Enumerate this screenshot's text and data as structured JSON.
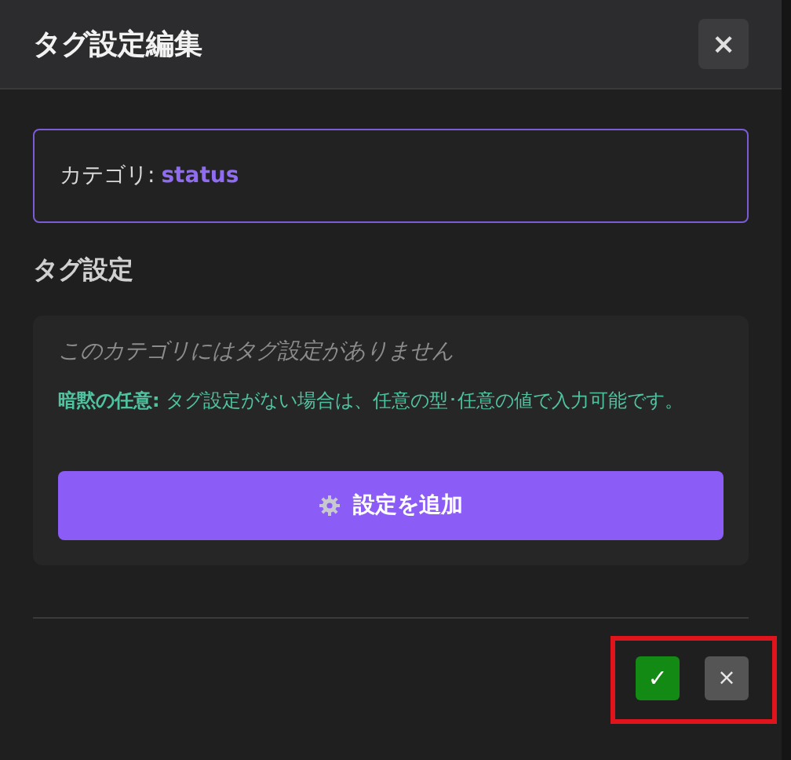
{
  "dialog": {
    "title": "タグ設定編集",
    "close": "×"
  },
  "category": {
    "label": "カテゴリ:",
    "value": "status"
  },
  "section": {
    "title": "タグ設定",
    "empty_message": "このカテゴリにはタグ設定がありません",
    "hint": "**暗黙の任意:** タグ設定がない場合は、任意の型･任意の値で入力可能です。",
    "add_button": "設定を追加"
  },
  "footer": {
    "confirm": "✓",
    "cancel": "×",
    "highlighted": true
  }
}
